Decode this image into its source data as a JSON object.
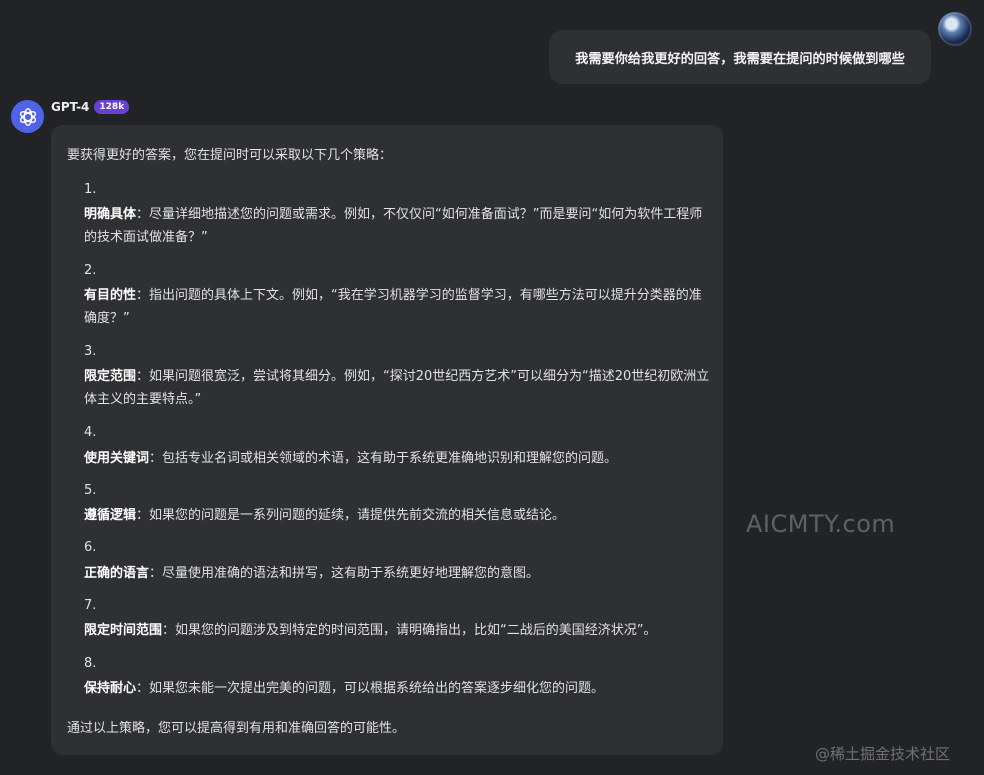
{
  "user_message": "我需要你给我更好的回答，我需要在提问的时候做到哪些",
  "assistant": {
    "name": "GPT-4",
    "badge": "128k",
    "intro": "要获得更好的答案，您在提问时可以采取以下几个策略：",
    "items": [
      {
        "number": "1.",
        "title": "明确具体",
        "text": "：尽量详细地描述您的问题或需求。例如，不仅仅问“如何准备面试？”而是要问“如何为软件工程师的技术面试做准备？”"
      },
      {
        "number": "2.",
        "title": "有目的性",
        "text": "：指出问题的具体上下文。例如，“我在学习机器学习的监督学习，有哪些方法可以提升分类器的准确度？”"
      },
      {
        "number": "3.",
        "title": "限定范围",
        "text": "：如果问题很宽泛，尝试将其细分。例如，“探讨20世纪西方艺术”可以细分为“描述20世纪初欧洲立体主义的主要特点。”"
      },
      {
        "number": "4.",
        "title": "使用关键词",
        "text": "：包括专业名词或相关领域的术语，这有助于系统更准确地识别和理解您的问题。"
      },
      {
        "number": "5.",
        "title": "遵循逻辑",
        "text": "：如果您的问题是一系列问题的延续，请提供先前交流的相关信息或结论。"
      },
      {
        "number": "6.",
        "title": "正确的语言",
        "text": "：尽量使用准确的语法和拼写，这有助于系统更好地理解您的意图。"
      },
      {
        "number": "7.",
        "title": "限定时间范围",
        "text": "：如果您的问题涉及到特定的时间范围，请明确指出，比如“二战后的美国经济状况”。"
      },
      {
        "number": "8.",
        "title": "保持耐心",
        "text": "：如果您未能一次提出完美的问题，可以根据系统给出的答案逐步细化您的问题。"
      }
    ],
    "outro": "通过以上策略，您可以提高得到有用和准确回答的可能性。"
  },
  "watermarks": [
    "AICMTY.com",
    "@稀土掘金技术社区"
  ],
  "colors": {
    "background": "#222327",
    "bubble": "#2f3034",
    "bot_avatar": "#4f63e8",
    "badge": "#6a3fd6"
  }
}
